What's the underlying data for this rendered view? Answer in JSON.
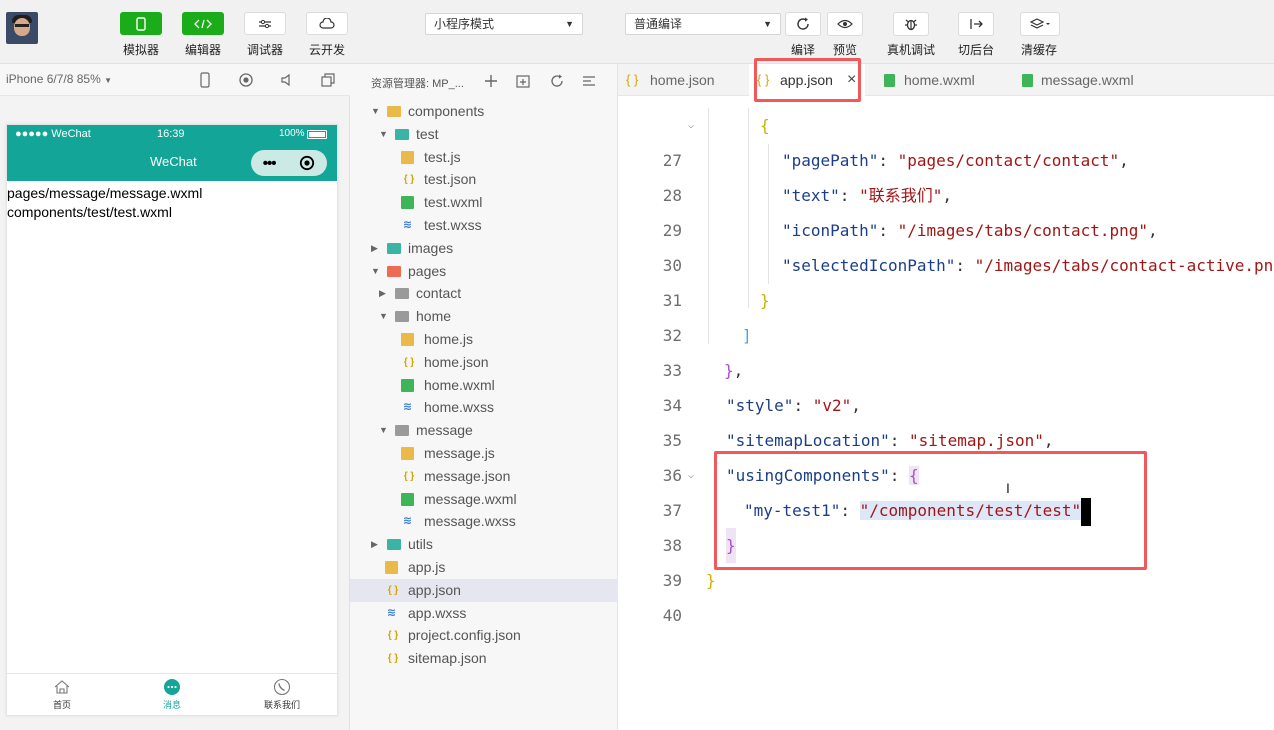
{
  "toolbar": {
    "buttons": [
      {
        "label": "模拟器",
        "icon": "phone-icon"
      },
      {
        "label": "编辑器",
        "icon": "code-icon"
      },
      {
        "label": "调试器",
        "icon": "debug-sliders-icon"
      },
      {
        "label": "云开发",
        "icon": "cloud-icon"
      }
    ],
    "mode_select": "小程序模式",
    "compile_select": "普通编译",
    "actions": [
      {
        "label": "编译",
        "icon": "refresh-icon"
      },
      {
        "label": "预览",
        "icon": "eye-icon"
      },
      {
        "label": "真机调试",
        "icon": "bug-icon"
      },
      {
        "label": "切后台",
        "icon": "background-switch-icon"
      },
      {
        "label": "清缓存",
        "icon": "layers-icon"
      }
    ]
  },
  "simulator": {
    "device": "iPhone 6/7/8 85%",
    "status": {
      "carrier": "●●●●● WeChat",
      "time": "16:39",
      "battery": "100%"
    },
    "nav_title": "WeChat",
    "page_lines": [
      "pages/message/message.wxml",
      "components/test/test.wxml"
    ],
    "tabs": [
      {
        "label": "首页",
        "icon": "home-icon"
      },
      {
        "label": "消息",
        "icon": "message-icon"
      },
      {
        "label": "联系我们",
        "icon": "phone-call-icon"
      }
    ]
  },
  "explorer": {
    "title": "资源管理器: MP_...",
    "tree": [
      {
        "name": "components",
        "type": "folder",
        "depth": 0,
        "open": true,
        "color": "#e9b949"
      },
      {
        "name": "test",
        "type": "folder",
        "depth": 1,
        "open": true,
        "color": "#3bb3a5"
      },
      {
        "name": "test.js",
        "type": "js",
        "depth": 2
      },
      {
        "name": "test.json",
        "type": "json",
        "depth": 2
      },
      {
        "name": "test.wxml",
        "type": "wxml",
        "depth": 2
      },
      {
        "name": "test.wxss",
        "type": "wxss",
        "depth": 2
      },
      {
        "name": "images",
        "type": "folder",
        "depth": 0,
        "open": false,
        "color": "#3bb3a5"
      },
      {
        "name": "pages",
        "type": "folder",
        "depth": 0,
        "open": true,
        "color": "#ef6a55"
      },
      {
        "name": "contact",
        "type": "folder",
        "depth": 1,
        "open": false,
        "color": "#9a9a9a"
      },
      {
        "name": "home",
        "type": "folder",
        "depth": 1,
        "open": true,
        "color": "#9a9a9a"
      },
      {
        "name": "home.js",
        "type": "js",
        "depth": 2
      },
      {
        "name": "home.json",
        "type": "json",
        "depth": 2
      },
      {
        "name": "home.wxml",
        "type": "wxml",
        "depth": 2
      },
      {
        "name": "home.wxss",
        "type": "wxss",
        "depth": 2
      },
      {
        "name": "message",
        "type": "folder",
        "depth": 1,
        "open": true,
        "color": "#9a9a9a"
      },
      {
        "name": "message.js",
        "type": "js",
        "depth": 2
      },
      {
        "name": "message.json",
        "type": "json",
        "depth": 2
      },
      {
        "name": "message.wxml",
        "type": "wxml",
        "depth": 2
      },
      {
        "name": "message.wxss",
        "type": "wxss",
        "depth": 2
      },
      {
        "name": "utils",
        "type": "folder",
        "depth": 0,
        "open": false,
        "color": "#3bb3a5"
      },
      {
        "name": "app.js",
        "type": "js",
        "depth": 0
      },
      {
        "name": "app.json",
        "type": "json",
        "depth": 0,
        "selected": true
      },
      {
        "name": "app.wxss",
        "type": "wxss",
        "depth": 0
      },
      {
        "name": "project.config.json",
        "type": "json",
        "depth": 0
      },
      {
        "name": "sitemap.json",
        "type": "json",
        "depth": 0
      }
    ]
  },
  "editor": {
    "tabs": [
      {
        "label": "home.json",
        "type": "json"
      },
      {
        "label": "app.json",
        "type": "json",
        "active": true
      },
      {
        "label": "home.wxml",
        "type": "wxml"
      },
      {
        "label": "message.wxml",
        "type": "wxml"
      }
    ],
    "close_glyph": "×",
    "lines": [
      {
        "no": "27",
        "fold": true
      },
      {
        "no": "28",
        "key": "\"pagePath\"",
        "value": "\"pages/contact/contact\""
      },
      {
        "no": "29",
        "key": "\"text\"",
        "value": "\"联系我们\""
      },
      {
        "no": "30",
        "key": "\"iconPath\"",
        "value": "\"/images/tabs/contact.png\""
      },
      {
        "no": "31",
        "key": "\"selectedIconPath\"",
        "value": "\"/images/tabs/contact-active.png\""
      },
      {
        "no": "32"
      },
      {
        "no": "33"
      },
      {
        "no": "34"
      },
      {
        "no": "35",
        "key": "\"style\"",
        "value": "\"v2\""
      },
      {
        "no": "36",
        "key": "\"sitemapLocation\"",
        "value": "\"sitemap.json\""
      },
      {
        "no": "37",
        "key": "\"usingComponents\"",
        "fold": true
      },
      {
        "no": "38",
        "key": "\"my-test1\"",
        "value": "\"/components/test/test\""
      },
      {
        "no": "39"
      },
      {
        "no": "40"
      }
    ]
  }
}
